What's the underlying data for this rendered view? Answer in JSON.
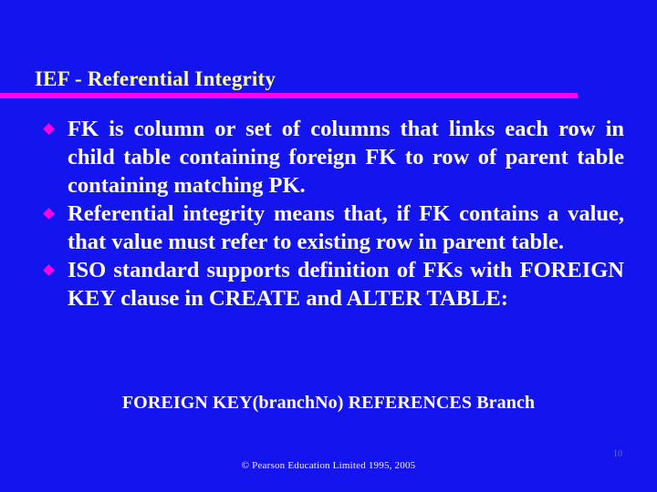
{
  "slide": {
    "background_color": "#1414EE",
    "title": "IEF - Referential Integrity",
    "title_color": "#FFFF9E",
    "rule_color": "#FF00F0",
    "bullet_color": "#FF00E4",
    "body_color": "#FFFFFF"
  },
  "body": {
    "bullets": [
      "FK is column or set of columns that links each row in child table containing foreign FK to row of parent table containing matching PK.",
      "Referential integrity means that, if FK contains a value, that value must refer to existing row in parent table.",
      "ISO standard supports definition of FKs with FOREIGN KEY clause in CREATE and ALTER TABLE:"
    ]
  },
  "code_example": {
    "text": "FOREIGN KEY(branchNo) REFERENCES Branch"
  },
  "footer": {
    "copyright": "© Pearson Education Limited 1995, 2005",
    "page_number": "10"
  }
}
